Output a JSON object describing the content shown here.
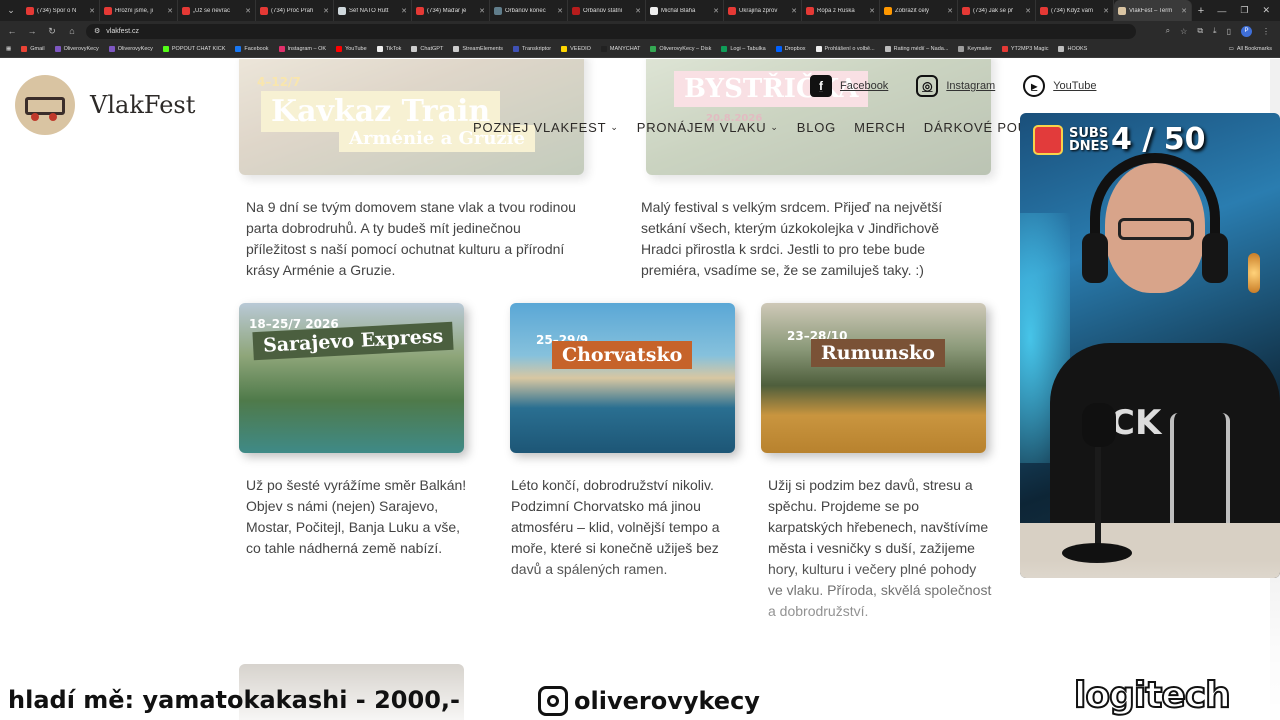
{
  "browser": {
    "tabs": [
      {
        "label": "(734) Spor o N",
        "color": "#e53935"
      },
      {
        "label": "Hrozní jsme, ji",
        "color": "#e53935"
      },
      {
        "label": "„Už se nevrac",
        "color": "#e53935"
      },
      {
        "label": "(734) Proč Prah",
        "color": "#e53935"
      },
      {
        "label": "Šéf NATO Rutt",
        "color": "#cfd8dc"
      },
      {
        "label": "(734) Maďar je",
        "color": "#e53935"
      },
      {
        "label": "Orbánův konec",
        "color": "#607d8b"
      },
      {
        "label": "Orbánův státní",
        "color": "#b71c1c"
      },
      {
        "label": "Michal Bláha",
        "color": "#eeeeee"
      },
      {
        "label": "Ukrajina zprov",
        "color": "#e53935"
      },
      {
        "label": "Ropa z Ruska",
        "color": "#e53935"
      },
      {
        "label": "Zobrazit celý",
        "color": "#ff9800"
      },
      {
        "label": "(734) Jak se př",
        "color": "#e53935"
      },
      {
        "label": "(734) Když vám",
        "color": "#e53935"
      },
      {
        "label": "VlakFest – Term",
        "color": "#d9c4a2",
        "active": true
      }
    ],
    "url": "vlakfest.cz",
    "profile_initial": "P",
    "bookmarks": [
      {
        "label": "Gmail",
        "color": "#ea4335"
      },
      {
        "label": "OliverovyKecy",
        "color": "#7e57c2"
      },
      {
        "label": "OliverovyKecy",
        "color": "#7e57c2"
      },
      {
        "label": "POPOUT CHAT KICK",
        "color": "#53fc18"
      },
      {
        "label": "Facebook",
        "color": "#1877f2"
      },
      {
        "label": "Instagram – OK",
        "color": "#e1306c"
      },
      {
        "label": "YouTube",
        "color": "#ff0000"
      },
      {
        "label": "TikTok",
        "color": "#eeeeee"
      },
      {
        "label": "ChatGPT",
        "color": "#cccccc"
      },
      {
        "label": "StreamElements",
        "color": "#cccccc"
      },
      {
        "label": "Transkriptor",
        "color": "#3f51b5"
      },
      {
        "label": "VEEDIO",
        "color": "#ffd600"
      },
      {
        "label": "MANYCHAT",
        "color": "#222222"
      },
      {
        "label": "OliverovyKecy – Disk",
        "color": "#34a853"
      },
      {
        "label": "Logi – Tabulka",
        "color": "#0f9d58"
      },
      {
        "label": "Dropbox",
        "color": "#0061ff"
      },
      {
        "label": "Prohlášení o volbě...",
        "color": "#eeeeee"
      },
      {
        "label": "Rating médií – Nada...",
        "color": "#bdbdbd"
      },
      {
        "label": "Keymailer",
        "color": "#9e9e9e"
      },
      {
        "label": "YT2MP3 Magic",
        "color": "#e53935"
      },
      {
        "label": "HOOKS",
        "color": "#bdbdbd"
      }
    ],
    "all_bookmarks": "All Bookmarks"
  },
  "site": {
    "logo_text": "VlakFest",
    "social": {
      "facebook": "Facebook",
      "instagram": "Instagram",
      "youtube": "YouTube"
    },
    "nav": {
      "item1": "POZNEJ VLAKFEST",
      "item2": "PRONÁJEM VLAKU",
      "item3": "BLOG",
      "item4": "MERCH",
      "item5": "DÁRKOVÉ POUKA"
    },
    "top_cards": {
      "kavkaz": {
        "banner": "Kavkaz Train",
        "subtitle": "Arménie a Gruzie",
        "date": "4–12/7"
      },
      "bystricka": {
        "banner": "BYSTŘIČKA",
        "date": "20.8.2026"
      }
    },
    "desc_kavkaz": "Na 9 dní se tvým domovem stane vlak a tvou rodinou parta dobrodruhů. A ty budeš mít jedinečnou příležitost s naší pomocí ochutnat kulturu a přírodní krásy Arménie a Gruzie.",
    "desc_bystricka": "Malý festival s velkým srdcem. Přijeď na největší setkání všech, kterým úzkokolejka v Jindřichově Hradci přirostla k srdci. Jestli to pro tebe bude premiéra, vsadíme se, že se zamiluješ taky. :)",
    "cards": {
      "sarajevo": {
        "date": "18–25/7 2026",
        "title": "Sarajevo Express",
        "desc": "Už po šesté vyrážíme směr Balkán! Objev s námi (nejen) Sarajevo, Mostar, Počitejl, Banja Luku a vše, co tahle nádherná země nabízí."
      },
      "chorvatsko": {
        "date": "25–29/9",
        "title": "Chorvatsko",
        "desc": "Léto končí, dobrodružství nikoliv. Podzimní Chorvatsko má jinou atmosféru – klid, volnější tempo a moře, které si konečně užiješ bez davů a spálených ramen."
      },
      "rumunsko": {
        "date": "23–28/10",
        "title": "Rumunsko",
        "desc": "Užij si podzim bez davů, stresu a spěchu. Projdeme se po karpatských hřebenech, navštívíme města i vesničky s duší, zažijeme hory, kulturu i večery plné pohody ve vlaku. Příroda, skvělá společnost a dobrodružství."
      }
    }
  },
  "stream": {
    "subs_label": "SUBS DNES",
    "subs_count": "4 / 50",
    "ticker": "hladí mě: yamatokakashi - 2000,-",
    "instagram_handle": "oliverovykecy",
    "sponsor": "logitech",
    "shirt_text": "CK"
  }
}
